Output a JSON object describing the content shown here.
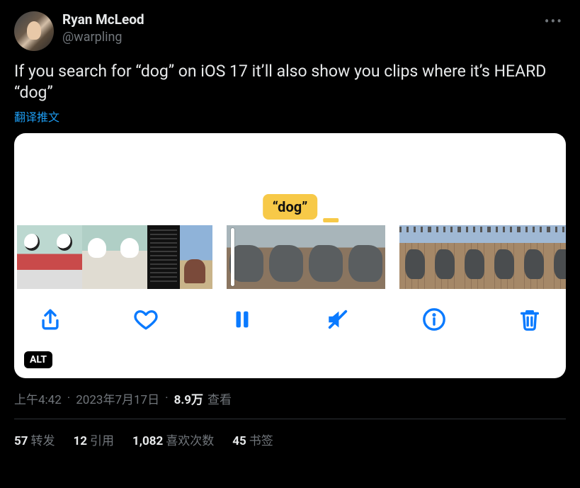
{
  "author": {
    "display_name": "Ryan McLeod",
    "handle": "@warpling"
  },
  "body": "If you search for “dog” on iOS 17 it’ll also show you clips where it’s HEARD “dog”",
  "translate_label": "翻译推文",
  "media": {
    "search_pill": "“dog”",
    "alt_badge": "ALT"
  },
  "meta": {
    "time": "上午4:42",
    "date": "2023年7月17日",
    "views_value": "8.9万",
    "views_suffix": "查看"
  },
  "stats": {
    "retweets": {
      "value": "57",
      "label": "转发"
    },
    "quotes": {
      "value": "12",
      "label": "引用"
    },
    "likes": {
      "value": "1,082",
      "label": "喜欢次数"
    },
    "bookmarks": {
      "value": "45",
      "label": "书签"
    }
  }
}
